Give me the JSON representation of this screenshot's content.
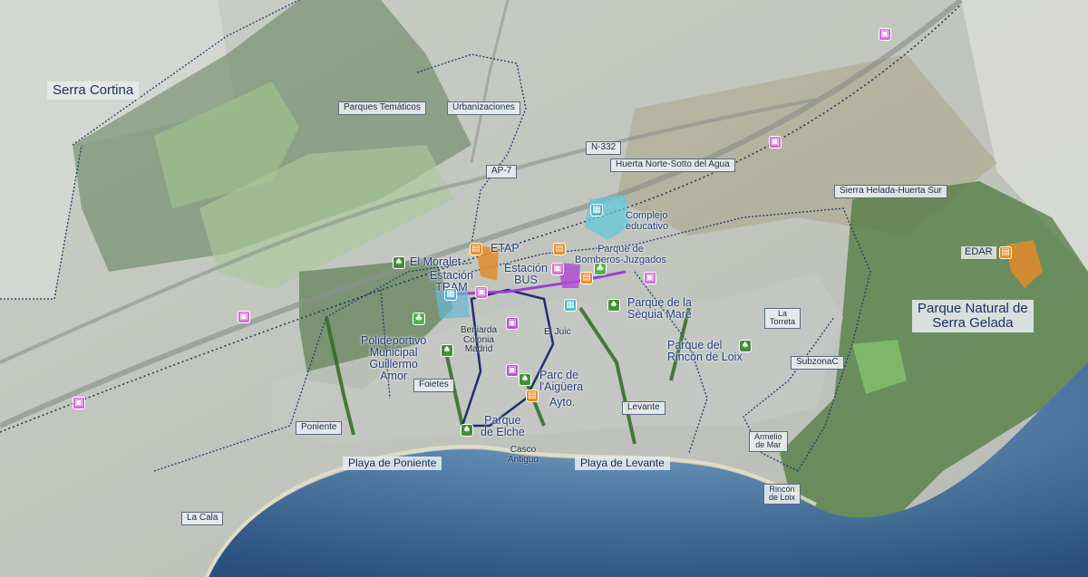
{
  "labels": {
    "serra_cortina": "Serra Cortina",
    "parques_tematicos": "Parques Temáticos",
    "urbanizaciones": "Urbanizaciones",
    "n332": "N-332",
    "ap7": "AP-7",
    "huerta_norte": "Huerta Norte-Sotto del Agua",
    "sierra_helada_huerta": "Sierra Helada-Huerta Sur",
    "complejo_educativo": "Complejo\neducativo",
    "etap": "ETAP",
    "parque_bomberos": "Parque de\nBomberos-Juzgados",
    "el_moralet": "El Moralet",
    "estacion_tram": "Estación\nTRAM",
    "estacion_bus": "Estación\nBUS",
    "parque_sequia": "Parque de la\nSèquia Mare",
    "la_torreta": "La\nTorreta",
    "parque_rincon": "Parque del\nRincón de Loix",
    "edar": "EDAR",
    "parque_natural": "Parque Natural de\nSerra Gelada",
    "polideportivo": "Polideportivo\nMunicipal\nGuillermo\nAmor",
    "benidorm_colonia": "Beniarda\nColonia\nMadrid",
    "el_juic": "El Juic",
    "parc_aiguera": "Parc de\nl'Aigüera",
    "ayto": "Ayto.",
    "foietes": "Foietes",
    "subzona_c": "SubzonaC",
    "levante": "Levante",
    "poniente": "Poniente",
    "parque_elche": "Parque\nde Elche",
    "casco_antiguo": "Casco\nAntiguo",
    "playa_poniente": "Playa de Poniente",
    "playa_levante": "Playa de Levante",
    "armelio_mar": "Armelio\nde Mar",
    "rincon_loix": "Rincón\nde Loix",
    "la_cala": "La Cala"
  },
  "colors": {
    "sea": "#3f6f9f",
    "sea_light": "#7fa6c6",
    "park_green": "#4f8a3c",
    "boundary": "#22386e",
    "tram_line": "#9b3fd1",
    "road": "#8a8f8c"
  },
  "icons": [
    "train-icon",
    "park-icon",
    "education-icon",
    "industry-icon",
    "bus-icon"
  ]
}
